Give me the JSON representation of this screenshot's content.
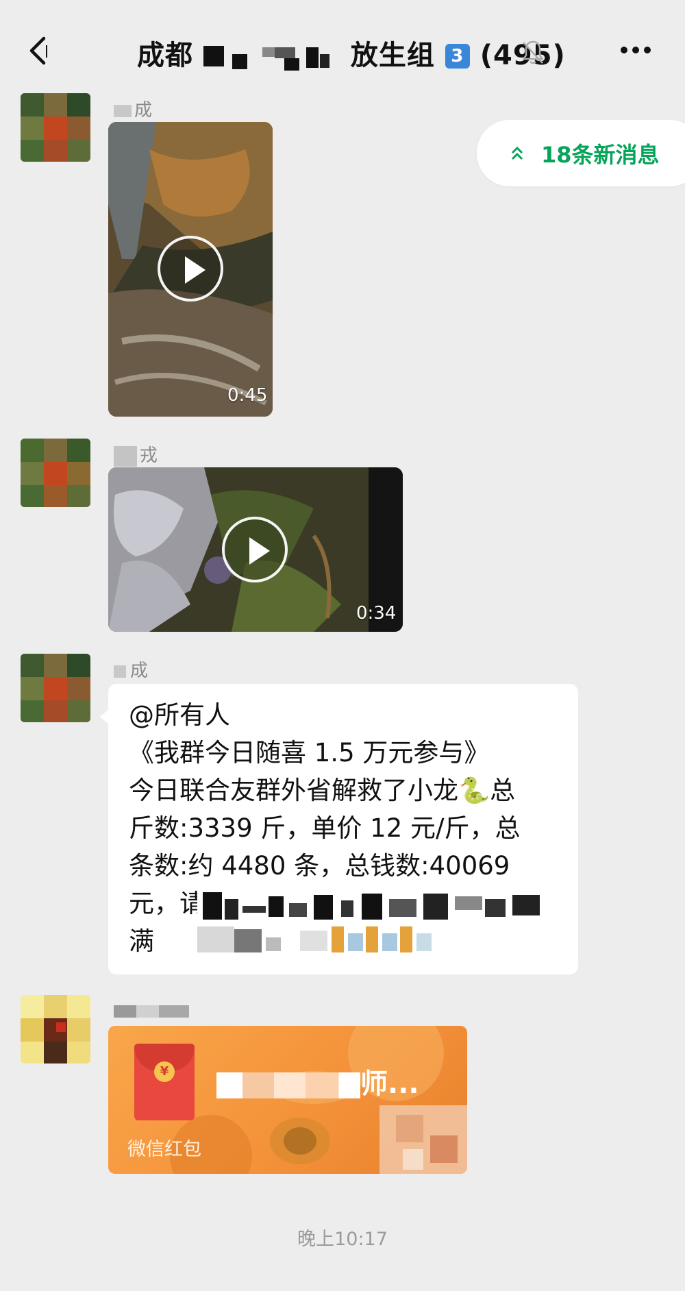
{
  "header": {
    "title_prefix": "成都",
    "title_suffix": "放生组",
    "badge_number": "3",
    "member_count": "(495)",
    "icons": [
      "back-icon",
      "bell-muted-icon",
      "more-dots-icon"
    ]
  },
  "new_messages": {
    "label": "18条新消息"
  },
  "messages": [
    {
      "type": "video",
      "sender": "成",
      "duration": "0:45"
    },
    {
      "type": "video",
      "sender": "戎",
      "duration": "0:34"
    },
    {
      "type": "text",
      "sender": "成",
      "lines": [
        "@所有人",
        "《我群今日随喜 1.5 万元参与》",
        "今日联合友群外省解救了小龙🐍总",
        "斤数:3339 斤，单价 12 元/斤，总",
        "条数:约 4480 条，总钱数:40069",
        "元，请",
        "满"
      ]
    },
    {
      "type": "red_packet",
      "title_start": "",
      "title_end": "师...",
      "label": "微信红包"
    }
  ],
  "timestamp": "晚上10:17",
  "colors": {
    "background": "#ededed",
    "accent_green": "#07a35a",
    "bubble": "#ffffff",
    "red_packet": "#f4923a"
  }
}
